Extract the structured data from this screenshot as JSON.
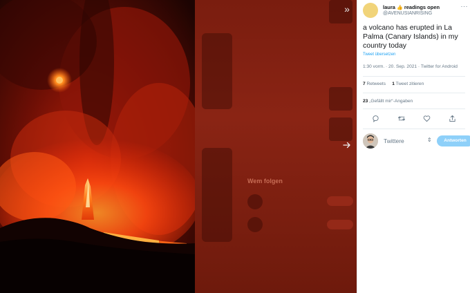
{
  "viewer": {
    "collapse_icon": "double-chevron-right-icon",
    "next_icon": "arrow-right-icon"
  },
  "tweet": {
    "author_name": "laura",
    "author_emoji": "👍",
    "author_status": "readings open",
    "author_handle": "@AVENUSIANRISING",
    "text": "a volcano has erupted in La Palma (Canary Islands) in my country today",
    "translate_label": "Tweet übersetzen",
    "meta": "1:30 vorm. · 20. Sep. 2021 · Twitter for Android",
    "retweets_count": "7",
    "retweets_label": "Retweets",
    "quotes_count": "1",
    "quotes_label": "Tweet zitieren",
    "likes_count": "23",
    "likes_label": "„Gefällt mir“-Angaben"
  },
  "actions": {
    "reply_icon": "reply-bubble-icon",
    "retweet_icon": "retweet-icon",
    "like_icon": "heart-icon",
    "share_icon": "share-icon"
  },
  "reply": {
    "placeholder": "Twittere",
    "button_label": "Antworten"
  },
  "background_page": {
    "who_to_follow": "Wem folgen"
  },
  "colors": {
    "accent": "#1da1f2",
    "reply_button_disabled": "#8ed0f9",
    "author_avatar": "#f1d47a"
  }
}
